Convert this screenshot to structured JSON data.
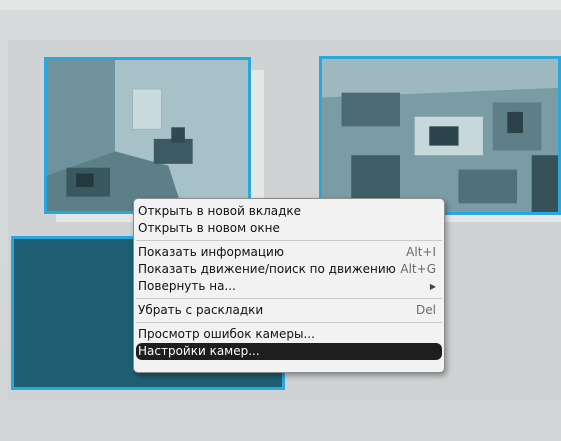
{
  "context_menu": {
    "groups": [
      [
        {
          "label": "Открыть в новой вкладке",
          "shortcut": ""
        },
        {
          "label": "Открыть в новом окне",
          "shortcut": ""
        }
      ],
      [
        {
          "label": "Показать информацию",
          "shortcut": "Alt+I"
        },
        {
          "label": "Показать движение/поиск по движению",
          "shortcut": "Alt+G"
        },
        {
          "label": "Повернуть на...",
          "shortcut": "",
          "submenu_icon": "submenu-arrow-icon"
        }
      ],
      [
        {
          "label": "Убрать с раскладки",
          "shortcut": "Del"
        }
      ],
      [
        {
          "label": "Просмотр ошибок камеры...",
          "shortcut": ""
        },
        {
          "label": "Настройки камер...",
          "shortcut": "",
          "selected": true
        }
      ]
    ]
  },
  "layout_tiles": [
    {
      "name": "camera-tile-1",
      "kind": "video"
    },
    {
      "name": "camera-tile-2",
      "kind": "video"
    },
    {
      "name": "camera-tile-3",
      "kind": "empty"
    }
  ],
  "colors": {
    "tile_border": "#2aa8de",
    "empty_tile": "#1f5f73",
    "menu_background": "#f2f2f2",
    "menu_selected": "#1e1e1e"
  }
}
